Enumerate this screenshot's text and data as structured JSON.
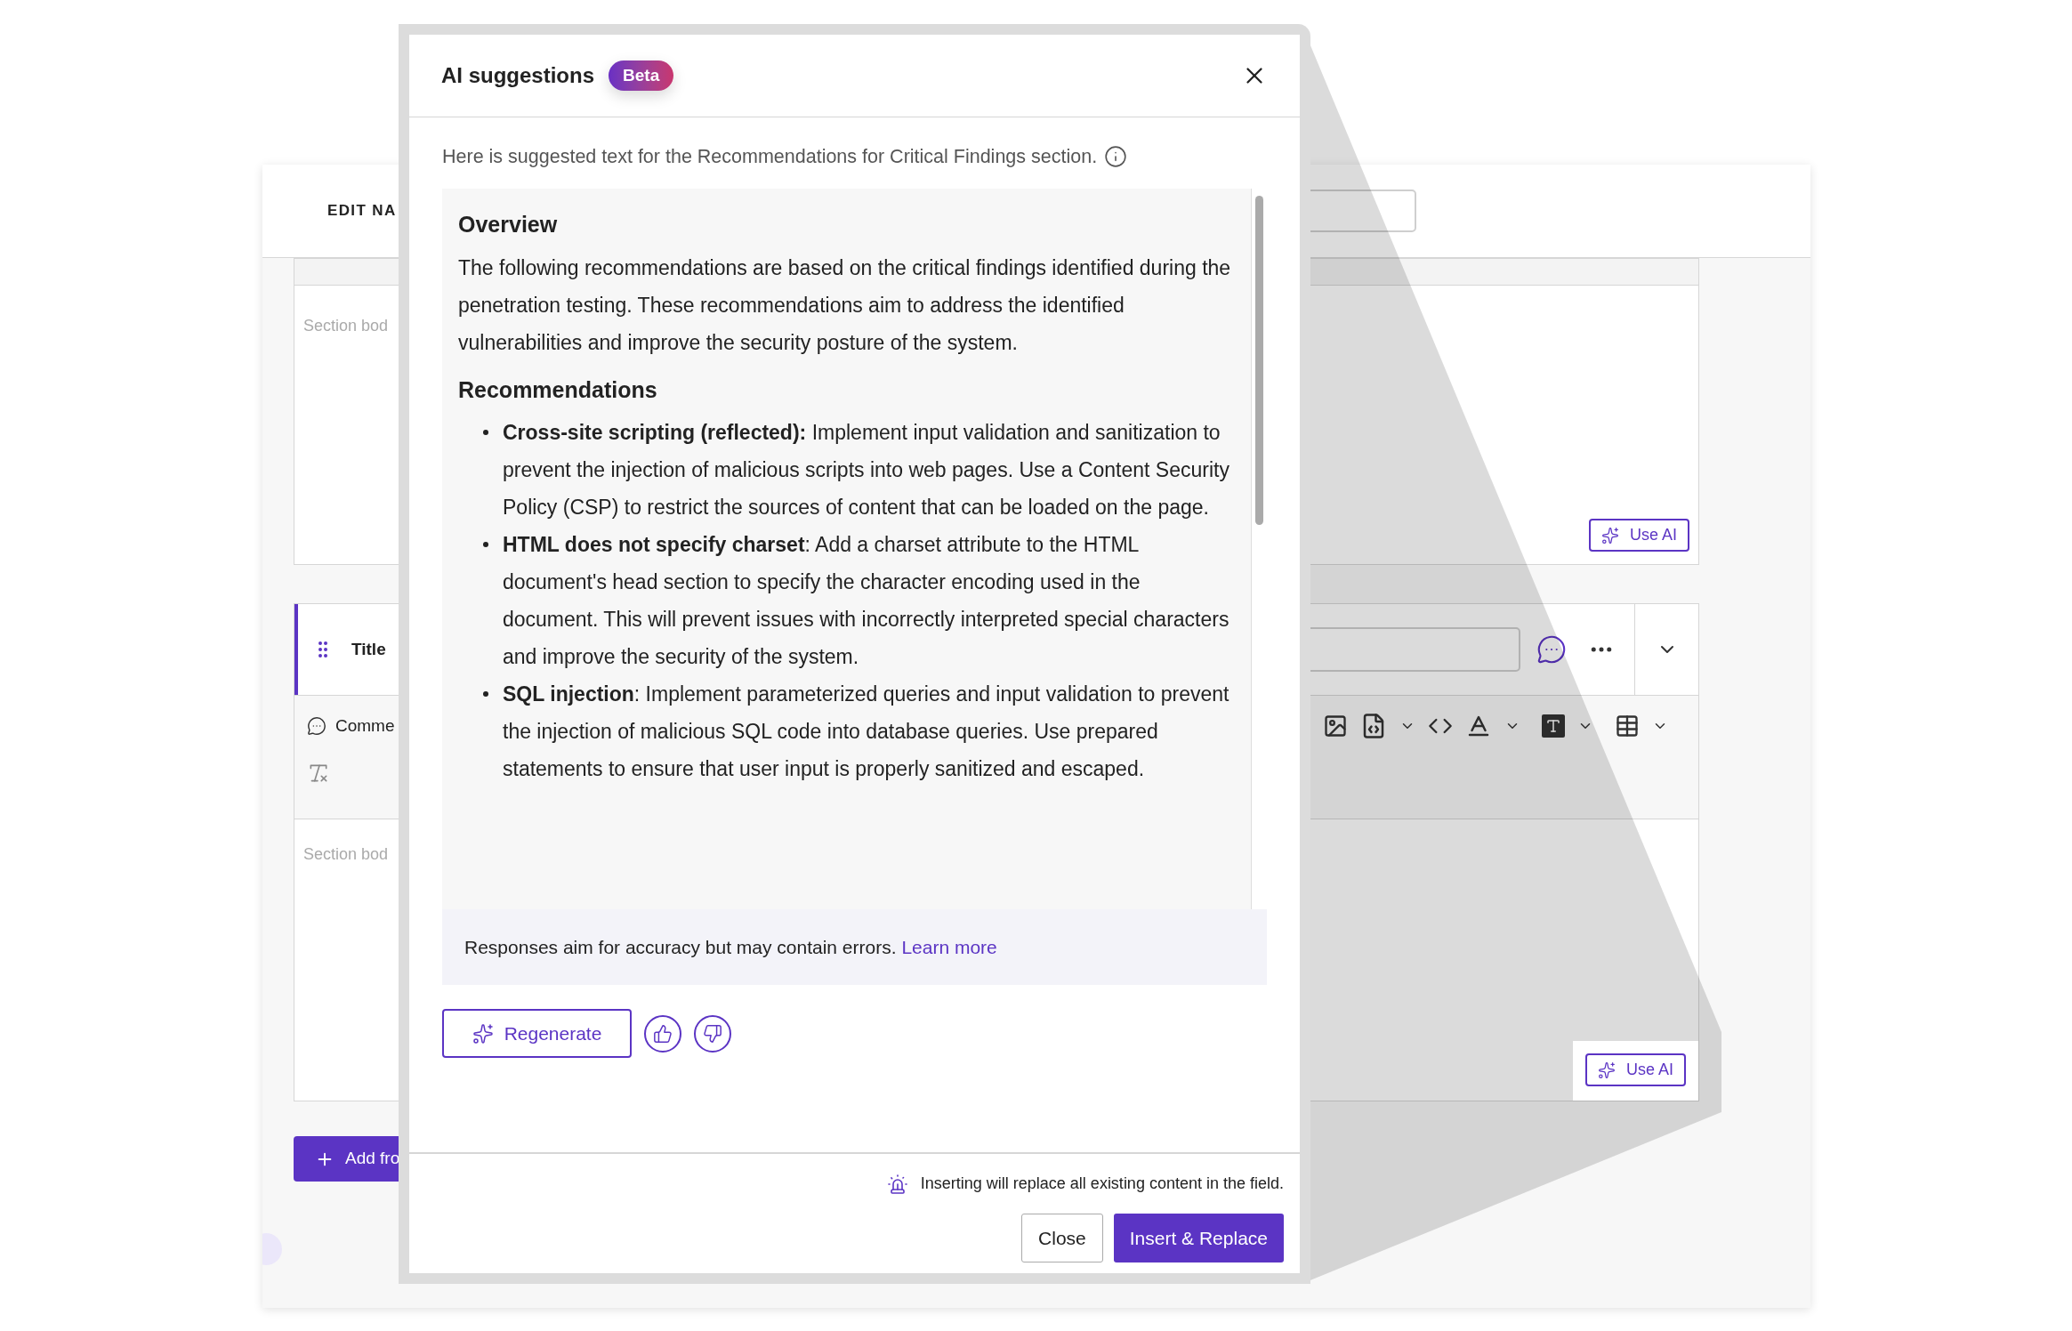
{
  "page_header": {
    "title": "EDIT NA"
  },
  "section_1": {
    "body_placeholder": "Section bod",
    "ai_button": "Use AI"
  },
  "section_2": {
    "title_label": "Title",
    "comments_label": "Comme",
    "body_placeholder": "Section bod",
    "ai_button": "Use AI"
  },
  "add_button": "Add fro",
  "modal": {
    "title": "AI suggestions",
    "badge": "Beta",
    "intro": "Here is suggested text for the Recommendations for Critical Findings section.",
    "content": [
      {
        "kind": "heading",
        "text": "Overview"
      },
      {
        "kind": "paragraph",
        "text": "The following recommendations are based on the critical findings identified during the penetration testing. These recommendations aim to address the identified vulnerabilities and improve the security posture of the system."
      },
      {
        "kind": "heading",
        "text": "Recommendations"
      },
      {
        "kind": "bullets",
        "items": [
          "**Cross-site scripting (reflected):** Implement input validation and sanitization to prevent the injection of malicious scripts into web pages. Use a Content Security Policy (CSP) to restrict the sources of content that can be loaded on the page.",
          "**HTML does not specify charset**: Add a charset attribute to the HTML document's head section to specify the character encoding used in the document. This will prevent issues with incorrectly interpreted special characters and improve the security of the system.",
          "**SQL injection**: Implement parameterized queries and input validation to prevent the injection of malicious SQL code into database queries. Use prepared statements to ensure that user input is properly sanitized and escaped."
        ]
      }
    ],
    "disclaimer": "Responses aim for accuracy but may contain errors.",
    "learn_more": "Learn more",
    "regenerate": "Regenerate",
    "warning": "Inserting will replace all existing content in the field.",
    "close_button": "Close",
    "insert_button": "Insert & Replace"
  }
}
